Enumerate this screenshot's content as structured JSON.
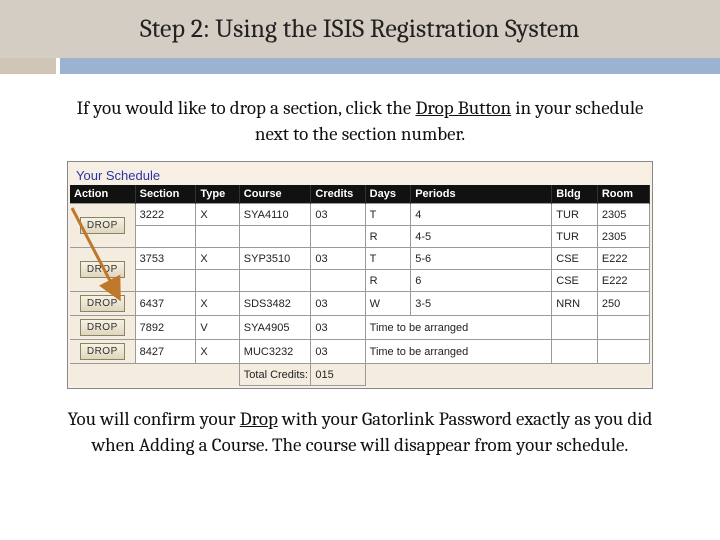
{
  "title": "Step 2: Using the ISIS Registration System",
  "instruction_top_pre": "If you would like to drop a section, click the ",
  "instruction_top_u": "Drop Button",
  "instruction_top_post": " in your schedule next to the section number.",
  "schedule_title": "Your Schedule",
  "headers": {
    "action": "Action",
    "section": "Section",
    "type": "Type",
    "course": "Course",
    "credits": "Credits",
    "days": "Days",
    "periods": "Periods",
    "bldg": "Bldg",
    "room": "Room"
  },
  "drop_label": "DROP",
  "rows": [
    {
      "section": "3222",
      "type": "X",
      "course": "SYA4110",
      "credits": "03",
      "days": "T",
      "periods": "4",
      "bldg": "TUR",
      "room": "2305"
    },
    {
      "section": "",
      "type": "",
      "course": "",
      "credits": "",
      "days": "R",
      "periods": "4-5",
      "bldg": "TUR",
      "room": "2305"
    },
    {
      "section": "3753",
      "type": "X",
      "course": "SYP3510",
      "credits": "03",
      "days": "T",
      "periods": "5-6",
      "bldg": "CSE",
      "room": "E222"
    },
    {
      "section": "",
      "type": "",
      "course": "",
      "credits": "",
      "days": "R",
      "periods": "6",
      "bldg": "CSE",
      "room": "E222"
    },
    {
      "section": "6437",
      "type": "X",
      "course": "SDS3482",
      "credits": "03",
      "days": "W",
      "periods": "3-5",
      "bldg": "NRN",
      "room": "250"
    },
    {
      "section": "7892",
      "type": "V",
      "course": "SYA4905",
      "credits": "03",
      "time_tba": "Time to be arranged",
      "bldg": "",
      "room": ""
    },
    {
      "section": "8427",
      "type": "X",
      "course": "MUC3232",
      "credits": "03",
      "time_tba": "Time to be arranged",
      "bldg": "",
      "room": ""
    }
  ],
  "total_label": "Total Credits:",
  "total_value": "015",
  "instruction_bottom_pre": "You will confirm your ",
  "instruction_bottom_u": "Drop",
  "instruction_bottom_post": " with your Gatorlink Password exactly as you did when Adding a Course. The course will disappear from your schedule."
}
